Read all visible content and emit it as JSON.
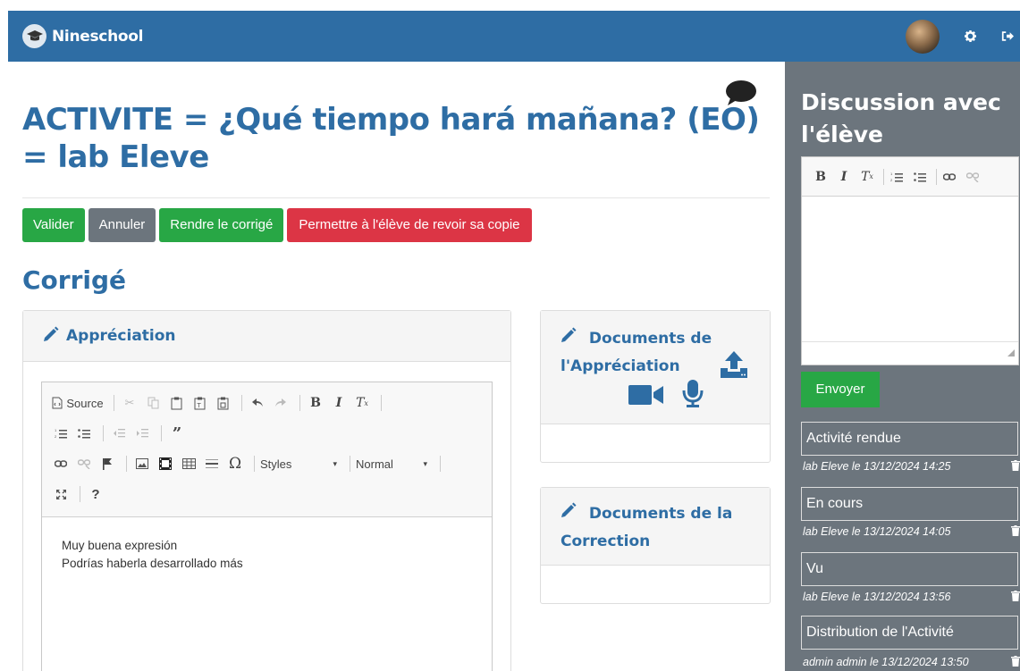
{
  "navbar": {
    "brand": "Nineschool",
    "icons": [
      "graduation-cap-icon",
      "gear-icon",
      "sign-out-icon"
    ]
  },
  "main": {
    "title": "ACTIVITE = ¿Qué tiempo hará mañana? (EO) = lab Eleve",
    "buttons": {
      "valider": "Valider",
      "annuler": "Annuler",
      "rendre": "Rendre le corrigé",
      "permettre": "Permettre à l'élève de revoir sa copie"
    },
    "section_title": "Corrigé",
    "appreciation": {
      "header": "Appréciation",
      "toolbar": {
        "source": "Source",
        "styles": "Styles",
        "format": "Normal"
      },
      "content_line1": "Muy buena expresión",
      "content_line2": "Podrías haberla desarrollado más"
    },
    "docs_appreciation": {
      "header": "Documents de l'Appréciation"
    },
    "docs_correction": {
      "header": "Documents de la Correction"
    }
  },
  "sidebar": {
    "title": "Discussion avec l'élève",
    "send_button": "Envoyer",
    "entries": [
      {
        "label": "Activité rendue",
        "meta": "lab Eleve le 13/12/2024 14:25"
      },
      {
        "label": "En cours",
        "meta": "lab Eleve le 13/12/2024 14:05"
      },
      {
        "label": "Vu",
        "meta": "lab Eleve le 13/12/2024 13:56"
      },
      {
        "label": "Distribution de l'Activité",
        "meta": "admin admin le 13/12/2024 13:50"
      }
    ]
  },
  "colors": {
    "primary": "#2e6da4",
    "success": "#28a745",
    "secondary": "#6c757d",
    "danger": "#dc3545"
  }
}
